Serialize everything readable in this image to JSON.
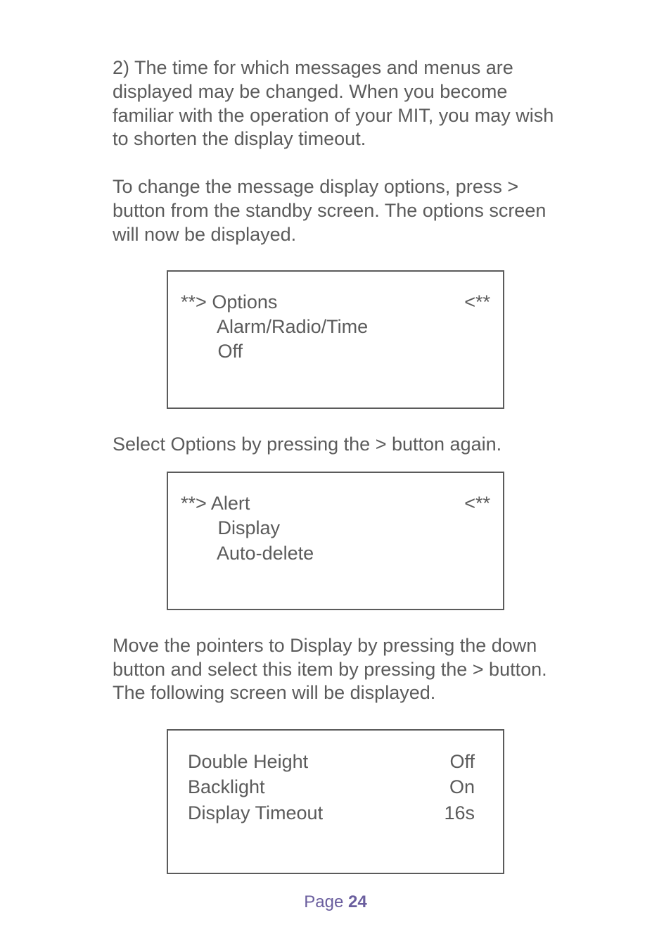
{
  "paragraphs": {
    "p1": "2) The time for which messages and menus are displayed may be changed.  When you become familiar with the operation of your MIT, you may wish to shorten the display timeout.",
    "p2": "To change the message display options, press > button from the standby screen.  The options screen will now be displayed.",
    "p3": "Select Options by pressing the > button again.",
    "p4": "Move the pointers to Display by pressing the down button and select this item by pressing the > button.  The following screen will be displayed."
  },
  "screen1": {
    "left_marker": "**>",
    "right_marker": "<**",
    "line1": "Options",
    "line2": "Alarm/Radio/Time",
    "line3": "Off"
  },
  "screen2": {
    "left_marker": "**>",
    "right_marker": "<**",
    "line1": "Alert",
    "line2": "Display",
    "line3": "Auto-delete"
  },
  "screen3": {
    "rows": [
      {
        "label": "Double Height",
        "value": "Off"
      },
      {
        "label": "Backlight",
        "value": "On"
      },
      {
        "label": "Display Timeout",
        "value": "16s"
      }
    ]
  },
  "footer": {
    "label": "Page",
    "number": "24"
  }
}
